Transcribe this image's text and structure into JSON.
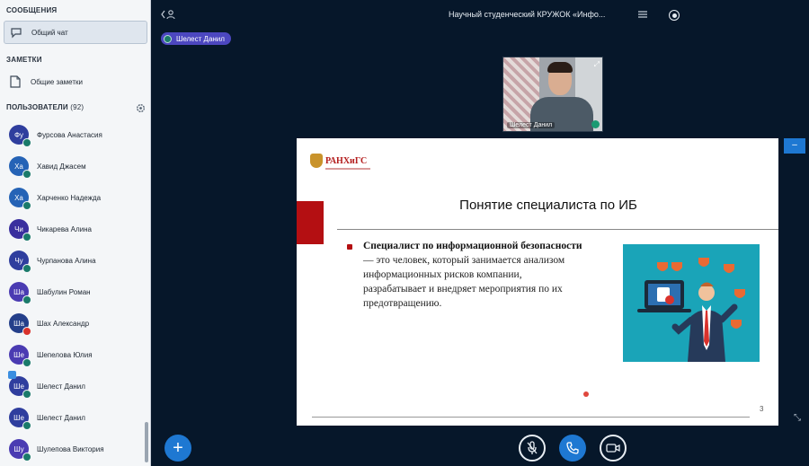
{
  "sidebar": {
    "messages_title": "СООБЩЕНИЯ",
    "public_chat_label": "Общий чат",
    "notes_title": "ЗАМЕТКИ",
    "shared_notes_label": "Общие заметки",
    "users_title": "ПОЛЬЗОВАТЕЛИ",
    "users_count": "(92)",
    "users": [
      {
        "initials": "Фу",
        "name": "Фурсова Анастасия",
        "color": "#2f3e9e",
        "badge": "headset"
      },
      {
        "initials": "Ха",
        "name": "Хавид Джасем",
        "color": "#2563b6",
        "badge": "headset"
      },
      {
        "initials": "Ха",
        "name": "Харченко Надежда",
        "color": "#2563b6",
        "badge": "headset"
      },
      {
        "initials": "Чи",
        "name": "Чикарева Алина",
        "color": "#3a2f9e",
        "badge": "headset"
      },
      {
        "initials": "Чу",
        "name": "Чурпанова Алина",
        "color": "#2f3e9e",
        "badge": "headset"
      },
      {
        "initials": "Ша",
        "name": "Шабулин Роман",
        "color": "#4a3bb2",
        "badge": "headset"
      },
      {
        "initials": "Ша",
        "name": "Шах Александр",
        "color": "#243f8a",
        "badge": "muted"
      },
      {
        "initials": "Ше",
        "name": "Шепелова Юлия",
        "color": "#4a3bb2",
        "badge": "headset"
      },
      {
        "initials": "Ше",
        "name": "Шелест Данил",
        "color": "#2f3e9e",
        "badge": "headset"
      },
      {
        "initials": "Ше",
        "name": "Шелест Данил",
        "color": "#2f3e9e",
        "badge": "headset"
      },
      {
        "initials": "Шу",
        "name": "Шулепова Виктория",
        "color": "#4a3bb2",
        "badge": "headset"
      }
    ]
  },
  "main": {
    "meeting_title": "Научный студенческий КРУЖОК «Инфо...",
    "presenter_name": "Шелест Данил",
    "webcam_name": "Шелест Данил"
  },
  "slide": {
    "logo_text": "РАНХиГС",
    "title": "Понятие специалиста по ИБ",
    "term": "Специалист по информационной безопасности",
    "definition": " — это человек, который занимается анализом информационных рисков компании, разрабатывает и внедряет мероприятия по их предотвращению.",
    "page_number": "3"
  },
  "colors": {
    "accent": "#1e78d2",
    "app_background": "#06172a",
    "slide_red": "#b40f12",
    "presenter_pill": "#4c47c0"
  },
  "icons": {
    "public_chat": "chat-bubble-icon",
    "shared_notes": "document-icon",
    "users_settings": "gear-icon",
    "add": "plus-icon",
    "mic": "microphone-icon",
    "phone": "phone-icon",
    "camera": "camera-icon"
  }
}
